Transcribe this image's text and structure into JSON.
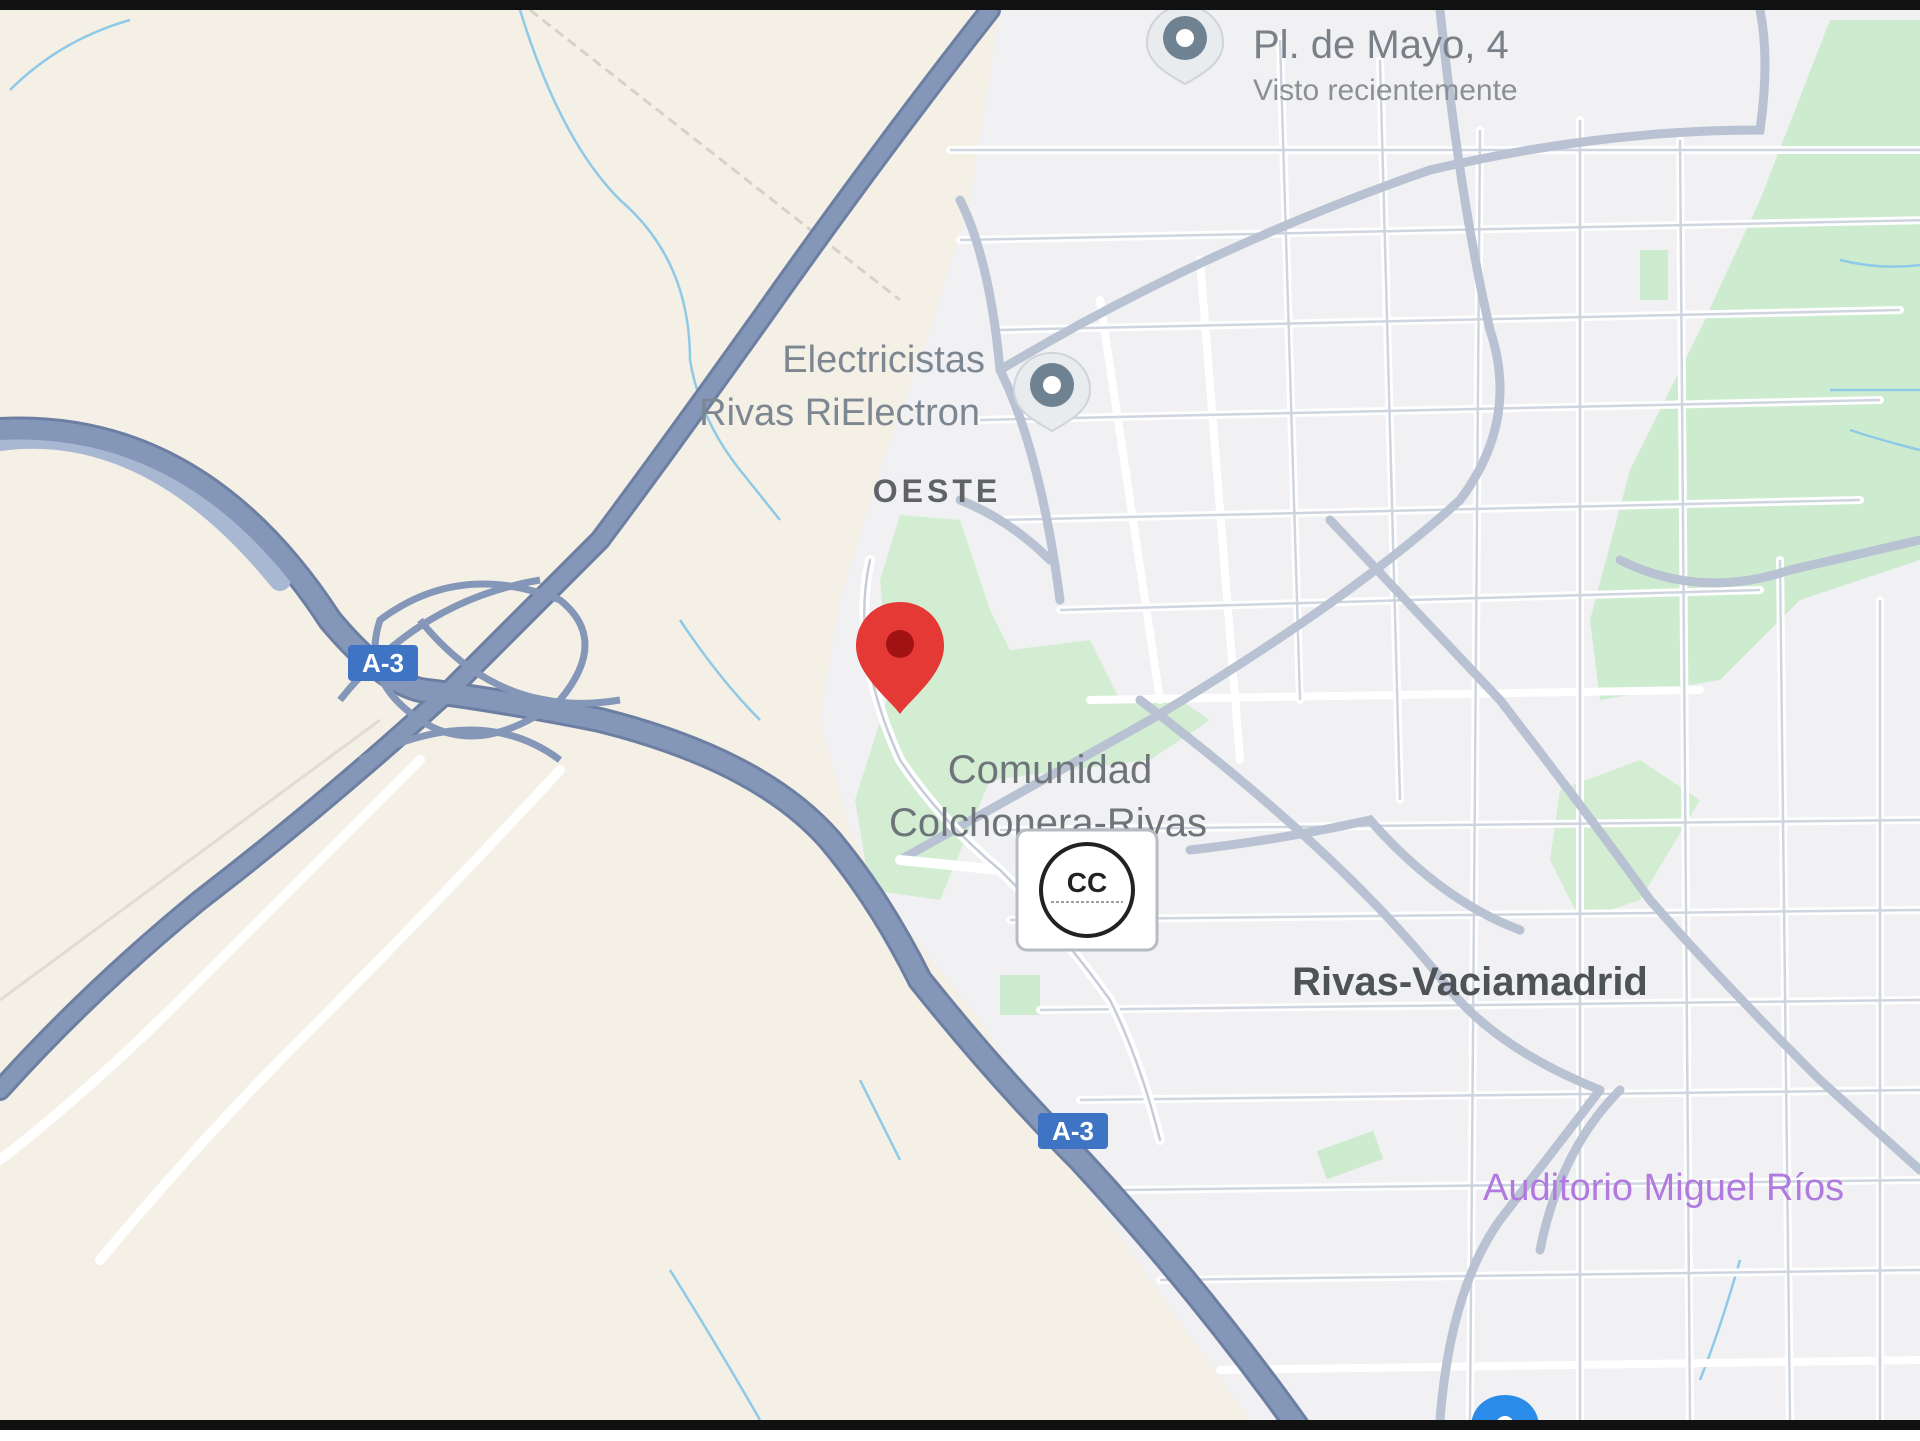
{
  "map": {
    "places": {
      "recent_place": {
        "name": "Pl. de Mayo, 4",
        "subtitle": "Visto recientemente"
      },
      "business": {
        "name_line1": "Electricistas",
        "name_line2": "Rivas RiElectron"
      },
      "venue": {
        "name_line1": "Comunidad",
        "name_line2": "Colchonera-Rivas"
      },
      "auditorium": {
        "name": "Auditorio Miguel Ríos"
      }
    },
    "district_label": "OESTE",
    "city_label": "Rivas-Vaciamadrid",
    "highway_shields": [
      "A-3",
      "A-3"
    ],
    "logo_badge": {
      "text": "CC"
    },
    "icons": {
      "selected_marker": "red-map-pin-icon",
      "poi_marker": "gray-place-pin-icon",
      "transit_marker": "blue-place-pin-icon"
    },
    "colors": {
      "land": "#f5f0e6",
      "urban": "#f1f1f3",
      "park": "#cdeccf",
      "highway": "#8597b8",
      "street": "#c9d0dc",
      "water": "#8fc9e8",
      "pin_red": "#e53935",
      "shield_blue": "#3f74c4",
      "auditorium_purple": "#b07ae0"
    }
  }
}
